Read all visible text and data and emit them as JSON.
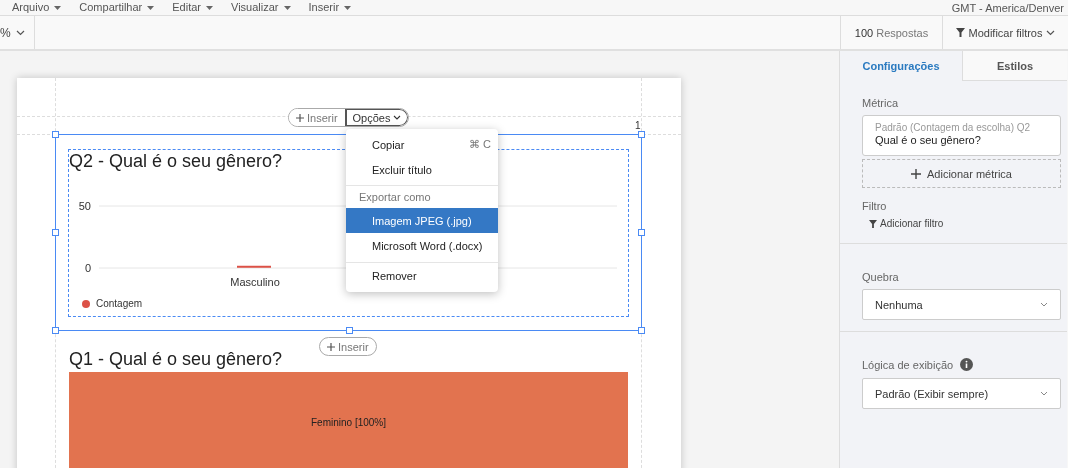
{
  "menu": [
    {
      "label": "Arquivo"
    },
    {
      "label": "Compartilhar"
    },
    {
      "label": "Editar"
    },
    {
      "label": "Visualizar"
    },
    {
      "label": "Inserir"
    }
  ],
  "timezone": "GMT - America/Denver",
  "toolbar": {
    "zoom": "%",
    "responses_count": "100",
    "responses_label": "Respostas",
    "filter_button": "Modificar filtros"
  },
  "page_number": "1",
  "widget_toolbar": {
    "insert": "Inserir",
    "options": "Opções"
  },
  "options_menu": [
    {
      "kind": "item",
      "label": "Copiar",
      "shortcut": "⌘ C",
      "selected": false
    },
    {
      "kind": "item",
      "label": "Excluir título",
      "selected": false
    },
    {
      "kind": "header",
      "label": "Exportar como"
    },
    {
      "kind": "item",
      "label": "Imagem JPEG (.jpg)",
      "selected": true
    },
    {
      "kind": "item",
      "label": "Microsoft Word (.docx)",
      "selected": false
    },
    {
      "kind": "item",
      "label": "Remover",
      "selected": false
    }
  ],
  "q2": {
    "title": "Q2 - Qual é o seu gênero?",
    "chart_data": {
      "type": "bar",
      "categories": [
        "Masculino"
      ],
      "series": [
        {
          "name": "Contagem",
          "color": "#dc5247",
          "values": [
            1
          ]
        }
      ],
      "ylim": [
        0,
        50
      ],
      "yticks": [
        0,
        50
      ]
    }
  },
  "insert_between": "Inserir",
  "q1": {
    "title": "Q1 - Qual é o seu gênero?",
    "segments": [
      {
        "label": "Feminino [100%]",
        "color": "#e2734f"
      }
    ]
  },
  "panel": {
    "tabs": [
      {
        "label": "Configurações",
        "selected": true
      },
      {
        "label": "Estilos",
        "selected": false
      }
    ],
    "metric": {
      "label": "Métrica",
      "hint": "Padrão (Contagem da escolha) Q2",
      "value": "Qual é o seu gênero?",
      "add": "Adicionar métrica"
    },
    "filter": {
      "label": "Filtro",
      "add": "Adicionar filtro"
    },
    "breakdown": {
      "label": "Quebra",
      "value": "Nenhuma"
    },
    "display_logic": {
      "label": "Lógica de exibição",
      "value": "Padrão (Exibir sempre)"
    }
  }
}
